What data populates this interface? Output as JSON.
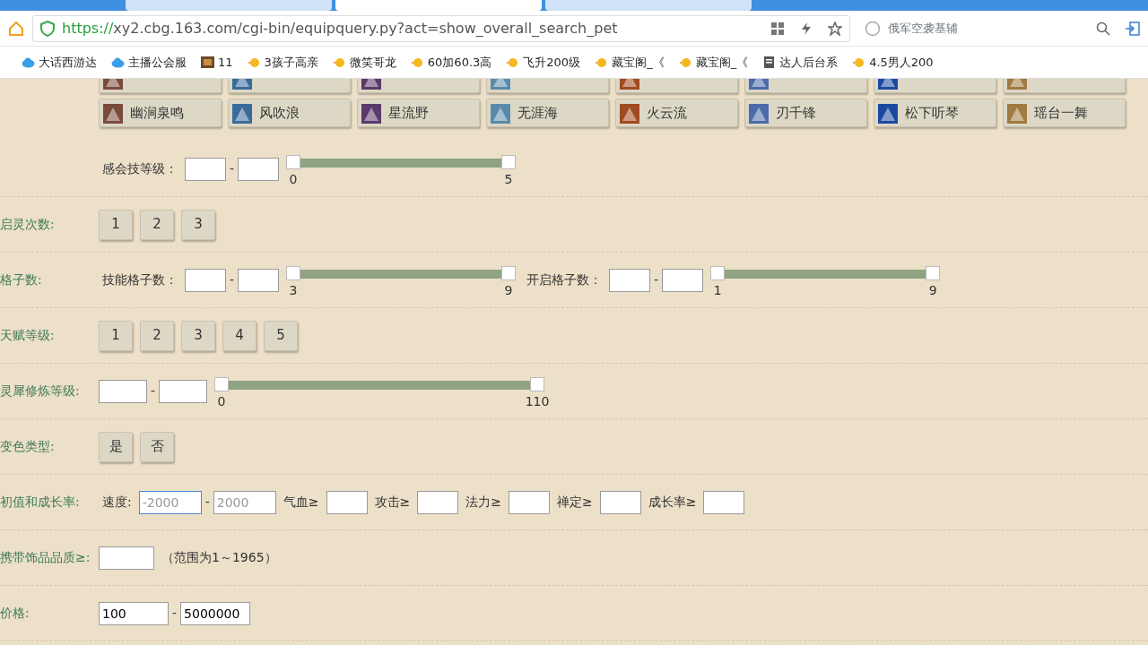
{
  "browser": {
    "tabs": [
      {
        "selected": false
      },
      {
        "selected": true
      },
      {
        "selected": false
      }
    ],
    "url_scheme": "https://",
    "url_rest": "xy2.cbg.163.com/cgi-bin/equipquery.py?act=show_overall_search_pet",
    "search": "俄军空袭基辅",
    "bookmarks": [
      {
        "kind": "cloud",
        "text": "大话西游达"
      },
      {
        "kind": "cloud",
        "text": "主播公会服"
      },
      {
        "kind": "game",
        "text": "11"
      },
      {
        "kind": "chick",
        "text": "3孩子高亲"
      },
      {
        "kind": "chick",
        "text": "微笑哥龙"
      },
      {
        "kind": "chick",
        "text": "60加60.3高"
      },
      {
        "kind": "chick",
        "text": "飞升200级"
      },
      {
        "kind": "chick",
        "text": "藏宝阁_《"
      },
      {
        "kind": "chick",
        "text": "藏宝阁_《"
      },
      {
        "kind": "page",
        "text": "达人后台系"
      },
      {
        "kind": "chick",
        "text": "4.5男人200"
      }
    ]
  },
  "skills": [
    {
      "kind": "cut"
    },
    {
      "kind": "cut"
    },
    {
      "kind": "cut"
    },
    {
      "kind": "cut"
    },
    {
      "kind": "cut"
    },
    {
      "kind": "cut"
    },
    {
      "kind": "cut"
    },
    {
      "kind": "cut"
    },
    {
      "kind": "named",
      "name": "幽涧泉鸣"
    },
    {
      "kind": "named",
      "name": "风吹浪"
    },
    {
      "kind": "named",
      "name": "星流野"
    },
    {
      "kind": "named",
      "name": "无涯海"
    },
    {
      "kind": "named",
      "name": "火云流"
    },
    {
      "kind": "named",
      "name": "刃千锋"
    },
    {
      "kind": "named",
      "name": "松下听琴"
    },
    {
      "kind": "named",
      "name": "瑶台一舞"
    }
  ],
  "rows": [
    {
      "items": [
        {
          "kind": "text",
          "text": "感会技等级："
        },
        {
          "kind": "input"
        },
        {
          "kind": "dash",
          "text": "-"
        },
        {
          "kind": "input"
        },
        {
          "kind": "slider",
          "thumbs": [
            {
              "level": 0
            },
            {
              "level": 1
            }
          ],
          "min": "0",
          "max": "5"
        }
      ]
    },
    {
      "label": "启灵次数:",
      "items": [
        {
          "kind": "option",
          "text": "1",
          "selected": false
        },
        {
          "kind": "option",
          "text": "2",
          "selected": false
        },
        {
          "kind": "option",
          "text": "3",
          "selected": false
        }
      ]
    },
    {
      "label": "格子数:",
      "items": [
        {
          "kind": "text",
          "text": "技能格子数："
        },
        {
          "kind": "input"
        },
        {
          "kind": "dash",
          "text": "-"
        },
        {
          "kind": "input"
        },
        {
          "kind": "slider",
          "thumbs": [
            {
              "level": 0
            },
            {
              "level": 1
            }
          ],
          "min": "3",
          "max": "9"
        },
        {
          "kind": "text",
          "text": "开启格子数："
        },
        {
          "kind": "input"
        },
        {
          "kind": "dash",
          "text": "-"
        },
        {
          "kind": "input"
        },
        {
          "kind": "slider",
          "thumbs": [
            {
              "level": 0
            },
            {
              "level": 1
            }
          ],
          "min": "1",
          "max": "9"
        }
      ]
    },
    {
      "label": "天赋等级:",
      "items": [
        {
          "kind": "option",
          "text": "1",
          "selected": false
        },
        {
          "kind": "option",
          "text": "2",
          "selected": false
        },
        {
          "kind": "option",
          "text": "3",
          "selected": false
        },
        {
          "kind": "option",
          "text": "4",
          "selected": false
        },
        {
          "kind": "option",
          "text": "5",
          "selected": false
        }
      ]
    },
    {
      "label": "灵犀修炼等级:",
      "items": [
        {
          "kind": "input"
        },
        {
          "kind": "dash",
          "text": "-"
        },
        {
          "kind": "input"
        },
        {
          "kind": "slider",
          "thumbs": [
            {
              "level": 0
            },
            {
              "level": 1
            }
          ],
          "min": "0",
          "max": "110"
        }
      ]
    },
    {
      "label": "变色类型:",
      "items": [
        {
          "kind": "option",
          "text": "是",
          "selected": false
        },
        {
          "kind": "option",
          "text": "否",
          "selected": false
        }
      ]
    },
    {
      "label": "初值和成长率:",
      "items": [
        {
          "kind": "text",
          "text": "速度:"
        },
        {
          "kind": "input",
          "placeholder": "-2000",
          "focused": true
        },
        {
          "kind": "dash",
          "text": "-"
        },
        {
          "kind": "input",
          "placeholder": "2000"
        },
        {
          "kind": "text",
          "text": "气血≥"
        },
        {
          "kind": "input"
        },
        {
          "kind": "text",
          "text": "攻击≥"
        },
        {
          "kind": "input"
        },
        {
          "kind": "text",
          "text": "法力≥"
        },
        {
          "kind": "input"
        },
        {
          "kind": "text",
          "text": "禅定≥"
        },
        {
          "kind": "input"
        },
        {
          "kind": "text",
          "text": "成长率≥"
        },
        {
          "kind": "input"
        }
      ]
    },
    {
      "label": "携带饰品品质≥:",
      "items": [
        {
          "kind": "input"
        },
        {
          "kind": "text",
          "text": "（范围为1～1965）"
        }
      ]
    },
    {
      "label": "价格:",
      "items": [
        {
          "kind": "input",
          "value": "100"
        },
        {
          "kind": "dash",
          "text": "-"
        },
        {
          "kind": "input",
          "value": "5000000"
        }
      ]
    }
  ]
}
